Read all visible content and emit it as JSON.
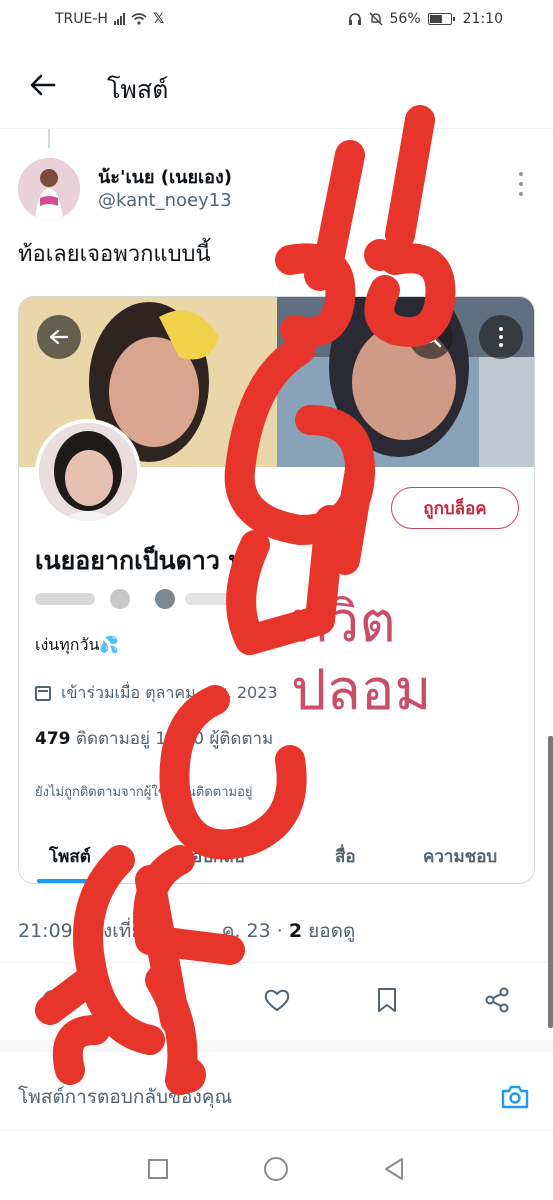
{
  "status_bar": {
    "carrier": "TRUE-H",
    "battery": "56%",
    "time": "21:10"
  },
  "header": {
    "title": "โพสต์"
  },
  "tweet": {
    "display_name": "น้ะ'เนย (เนยเอง)",
    "handle": "@kant_noey13",
    "text": "ท้อเลยเจอพวกแบบนี้",
    "timestamp": "21:09 หลังเที่ยง",
    "timestamp_rest": "ค. 23 · ",
    "views_count": "2",
    "views_label": " ยอดดู"
  },
  "embedded_profile": {
    "blocked_label": "ถูกบล็อค",
    "name": "เนยอยากเป็นดาว ทว",
    "bio": "เง่นทุกวัน💦",
    "joined": "เข้าร่วมเมื่อ ตุลาคม ค.ศ. 2023",
    "following_count": "479",
    "following_label": " ติดตามอยู่",
    "followers_label": " 1,120 ผู้ติดตาม",
    "not_followed": "ยังไม่ถูกติดตามจากผู้ใช้ที่คุณติดตามอยู่",
    "tabs": [
      "โพสต์",
      "ตอบกลับ",
      "สื่อ",
      "ความชอบ"
    ],
    "fake_label": "ทวิต ปลอม"
  },
  "reply": {
    "placeholder": "โพสต์การตอบกลับของคุณ"
  },
  "overlay": {
    "stamp_text": "มิจฉาชีพ!!",
    "color": "#e8352b"
  },
  "colors": {
    "accent": "#1d9bf0",
    "blocked": "#c9273c"
  }
}
